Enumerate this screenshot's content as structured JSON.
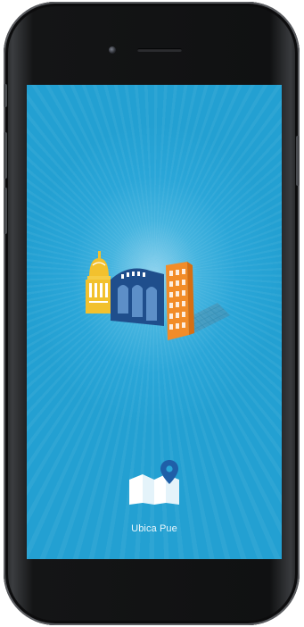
{
  "app": {
    "name": "Ubica Pue"
  },
  "splash": {
    "illustration": "city-buildings-illustration",
    "logo": "map-pin-logo-icon"
  },
  "colors": {
    "screen_background": "#2aa6d8",
    "dome_building": "#f2c12e",
    "arched_building": "#1f4e8c",
    "tower_building": "#f28c28",
    "logo_white": "#ffffff",
    "pin_blue": "#1f5fa8"
  }
}
